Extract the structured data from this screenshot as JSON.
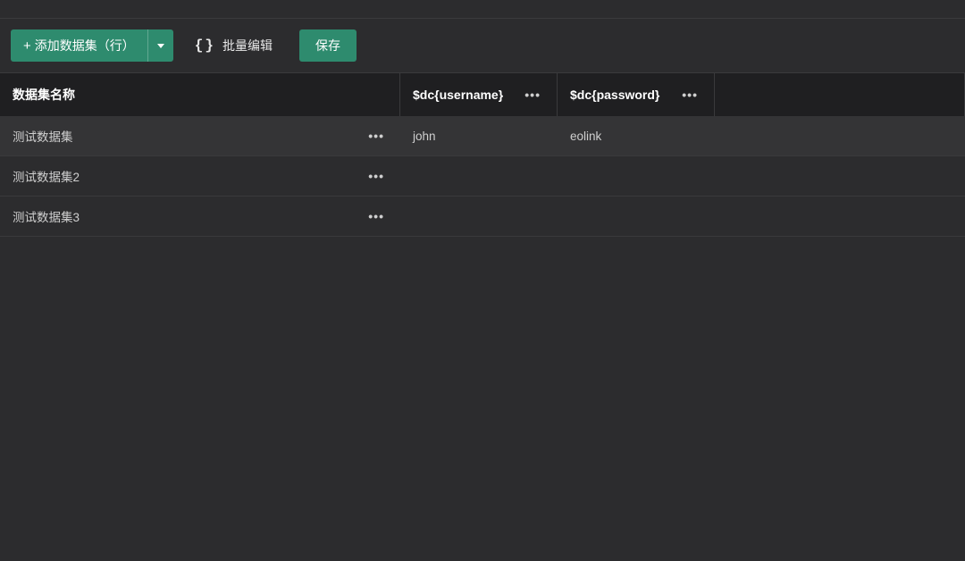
{
  "toolbar": {
    "add_button_label": "添加数据集（行）",
    "batch_edit_label": "批量编辑",
    "save_label": "保存"
  },
  "table": {
    "headers": {
      "name": "数据集名称",
      "col1": "$dc{username}",
      "col2": "$dc{password}"
    },
    "rows": [
      {
        "name": "测试数据集",
        "username": "john",
        "password": "eolink"
      },
      {
        "name": "测试数据集2",
        "username": "",
        "password": ""
      },
      {
        "name": "测试数据集3",
        "username": "",
        "password": ""
      }
    ]
  }
}
